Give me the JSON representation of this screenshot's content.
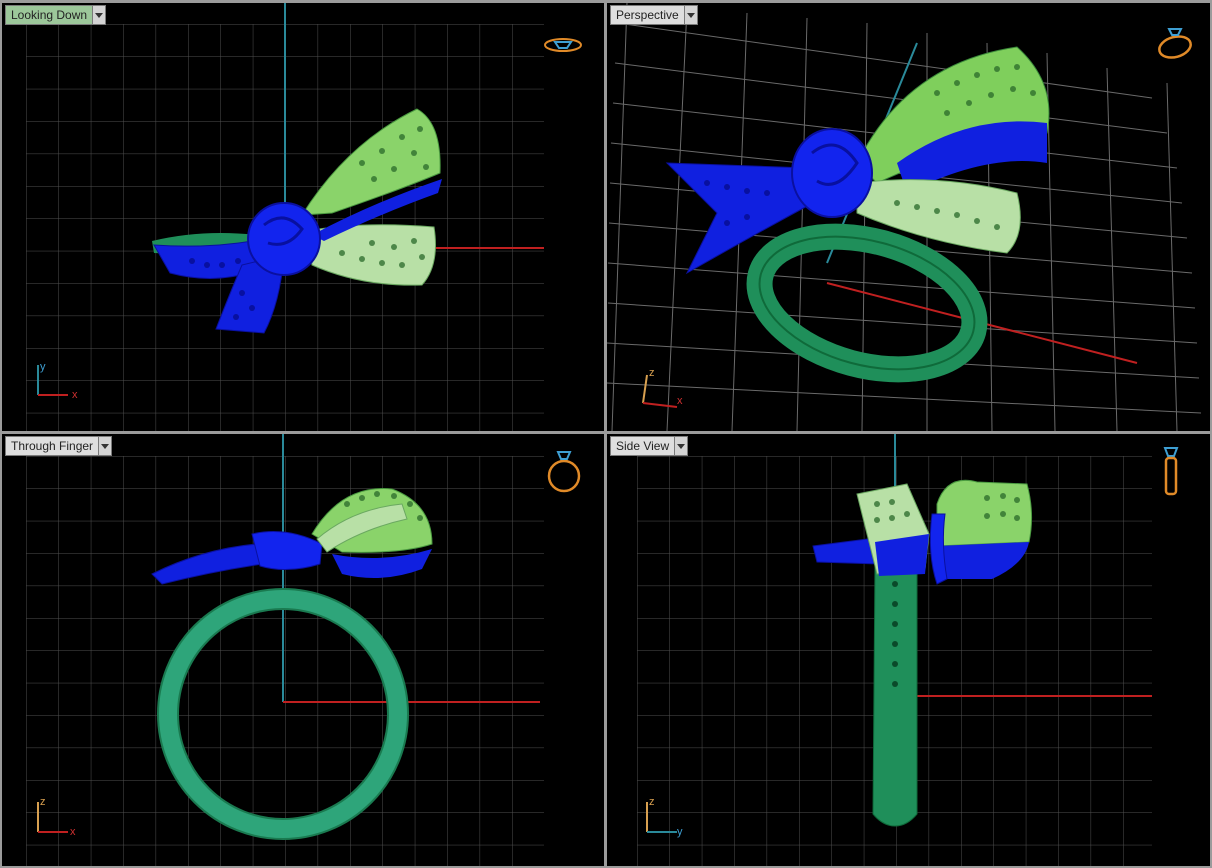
{
  "viewports": [
    {
      "label": "Looking Down",
      "axis_h": "x",
      "axis_v": "y",
      "active": true
    },
    {
      "label": "Perspective",
      "axis_h": "x",
      "axis_v": "z",
      "active": false
    },
    {
      "label": "Through Finger",
      "axis_h": "x",
      "axis_v": "z",
      "active": false
    },
    {
      "label": "Side View",
      "axis_h": "y",
      "axis_v": "z",
      "active": false
    }
  ],
  "icons": {
    "top_left": "ring-top-view-icon",
    "top_right": "ring-perspective-icon",
    "bottom_left": "ring-front-view-icon",
    "bottom_right": "ring-side-view-icon"
  },
  "colors": {
    "grid": "#505050",
    "axis_x": "#c02020",
    "axis_y": "#2a8a9a",
    "gizmo": "#e08a28",
    "band": "#1f8f5a",
    "bow_blue": "#1020e0",
    "bow_green": "#8ad36a",
    "bow_pale": "#b8e0a6",
    "active_tab": "#9cc79a"
  }
}
